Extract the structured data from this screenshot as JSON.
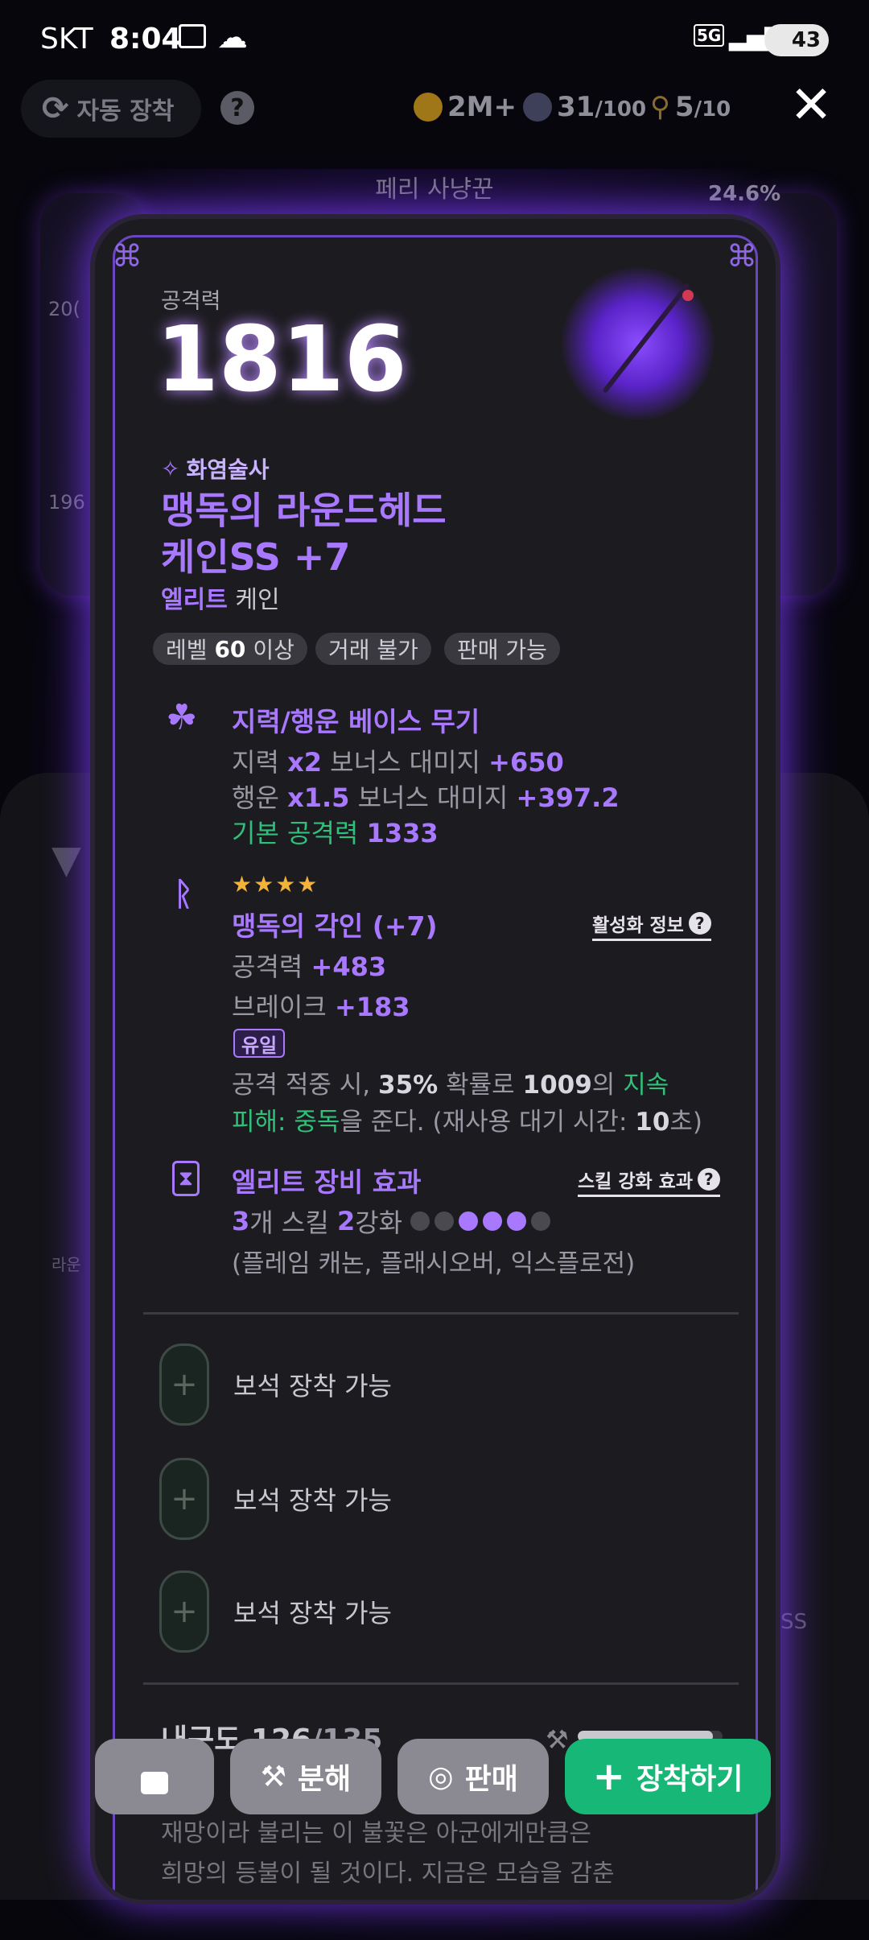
{
  "status_bar": {
    "carrier": "SKT",
    "time": "8:04",
    "network": "5G",
    "battery": "43"
  },
  "top_bar": {
    "auto_equip_label": "자동 장착",
    "help": "?",
    "gold": "2M+",
    "orb_current": "31",
    "orb_max": "/100",
    "key_current": "5",
    "key_max": "/10",
    "close": "✕"
  },
  "background": {
    "npc_role": "페리 사냥꾼",
    "percent": "24.6%",
    "side_numbers": [
      "20(",
      "196"
    ],
    "side_label_left": "라운",
    "side_label_right": "SS"
  },
  "card": {
    "attack_label": "공격력",
    "attack_value": "1816",
    "class_name": "화염술사",
    "item_name_line1": "맹독의 라운드헤드",
    "item_name_line2": "케인SS +7",
    "grade": "엘리트",
    "item_type": "케인",
    "chips": {
      "level_prefix": "레벨",
      "level_value": "60",
      "level_suffix": "이상",
      "no_trade": "거래 불가",
      "sellable": "판매 가능"
    },
    "base": {
      "title": "지력/행운 베이스 무기",
      "line1": {
        "stat": "지력",
        "mult": "x2",
        "mid": "보너스 대미지",
        "value": "+650"
      },
      "line2": {
        "stat": "행운",
        "mult": "x1.5",
        "mid": "보너스 대미지",
        "value": "+397.2"
      },
      "line3": {
        "label": "기본 공격력",
        "value": "1333"
      }
    },
    "engrave": {
      "stars": "★★★★",
      "title": "맹독의 각인 (+7)",
      "info_link": "활성화 정보",
      "attack": {
        "label": "공격력",
        "value": "+483"
      },
      "break": {
        "label": "브레이크",
        "value": "+183"
      },
      "unique_badge": "유일",
      "desc1_a": "공격 적중 시,",
      "desc1_b": "35%",
      "desc1_c": "확률로",
      "desc1_d": "1009",
      "desc1_e": "의",
      "desc1_f": "지속",
      "desc2_a": "피해:",
      "desc2_b": "중독",
      "desc2_c": "을 준다. (재사용 대기 시간:",
      "desc2_d": "10",
      "desc2_e": "초)"
    },
    "elite": {
      "title": "엘리트 장비 효과",
      "info_link": "스킬 강화 효과",
      "count": "3",
      "count_suffix": "개 스킬",
      "level": "2",
      "level_suffix": "강화",
      "dots_filled": [
        false,
        false,
        true,
        true,
        true,
        false
      ],
      "skills": "(플레임 캐논, 플래시오버, 익스플로전)"
    },
    "sockets": [
      "보석 장착 가능",
      "보석 장착 가능",
      "보석 장착 가능"
    ],
    "durability": {
      "label": "내구도",
      "current": "126",
      "max": "/135",
      "fraction": 0.933
    },
    "lore_line2": "재망이라 불리는 이 불꽃은 아군에게만큼은",
    "lore_line3": "희망의 등불이 될 것이다. 지금은 모습을 감춘"
  },
  "bottom_buttons": {
    "lock": "",
    "disassemble": "분해",
    "sell": "판매",
    "equip": "장착하기"
  },
  "colors": {
    "accent_purple": "#a879ff",
    "green": "#2fc07a",
    "equip_green": "#17b877",
    "gray_button": "#8b8a92"
  }
}
